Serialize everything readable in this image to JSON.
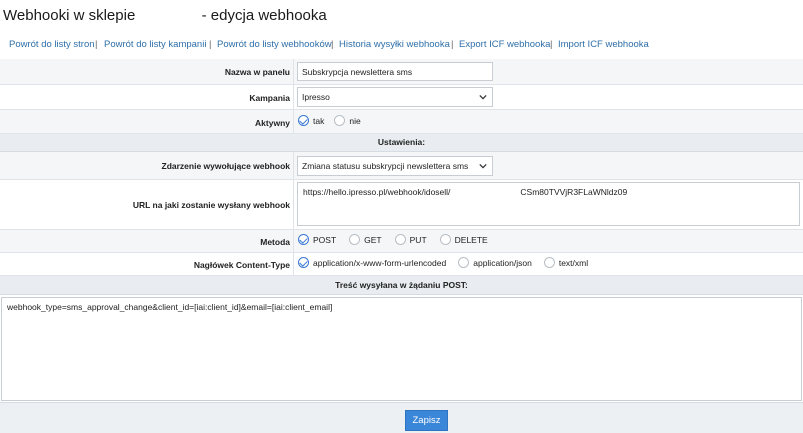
{
  "header": {
    "title_prefix": "Webhooki w sklepie",
    "title_suffix": "- edycja webhooka"
  },
  "nav": {
    "links": [
      "Powrót do listy stron",
      "Powrót do listy kampanii",
      "Powrót do listy webhooków",
      "Historia wysyłki webhooka",
      "Export ICF webhooka",
      "Import ICF webhooka"
    ],
    "separator": "|"
  },
  "form": {
    "name_label": "Nazwa w panelu",
    "name_value": "Subskrypcja newslettera sms",
    "campaign_label": "Kampania",
    "campaign_value": "Ipresso",
    "active_label": "Aktywny",
    "active_options": [
      "tak",
      "nie"
    ],
    "active_selected": "tak",
    "settings_heading": "Ustawienia:",
    "event_label": "Zdarzenie wywołujące webhook",
    "event_value": "Zmiana statusu subskrypcji newslettera sms",
    "url_label": "URL na jaki zostanie wysłany webhook",
    "url_value_start": "https://hello.ipresso.pl/webhook/idosell/",
    "url_value_end": "CSm80TVVjR3FLaWNldz09",
    "method_label": "Metoda",
    "method_options": [
      "POST",
      "GET",
      "PUT",
      "DELETE"
    ],
    "method_selected": "POST",
    "content_type_label": "Nagłówek Content-Type",
    "content_type_options": [
      "application/x-www-form-urlencoded",
      "application/json",
      "text/xml"
    ],
    "content_type_selected": "application/x-www-form-urlencoded",
    "body_heading": "Treść wysyłana w żądaniu POST:",
    "body_value": "webhook_type=sms_approval_change&client_id=[iai:client_id]&email=[iai:client_email]"
  },
  "footer": {
    "save_label": "Zapisz"
  },
  "colors": {
    "link": "#2f6fa8",
    "accent": "#3a86d8",
    "row_alt": "#f4f6f8",
    "section_head": "#e9edf1"
  },
  "icons": {
    "select_arrow": "chevron-down-icon",
    "radio_checked": "check-icon"
  }
}
